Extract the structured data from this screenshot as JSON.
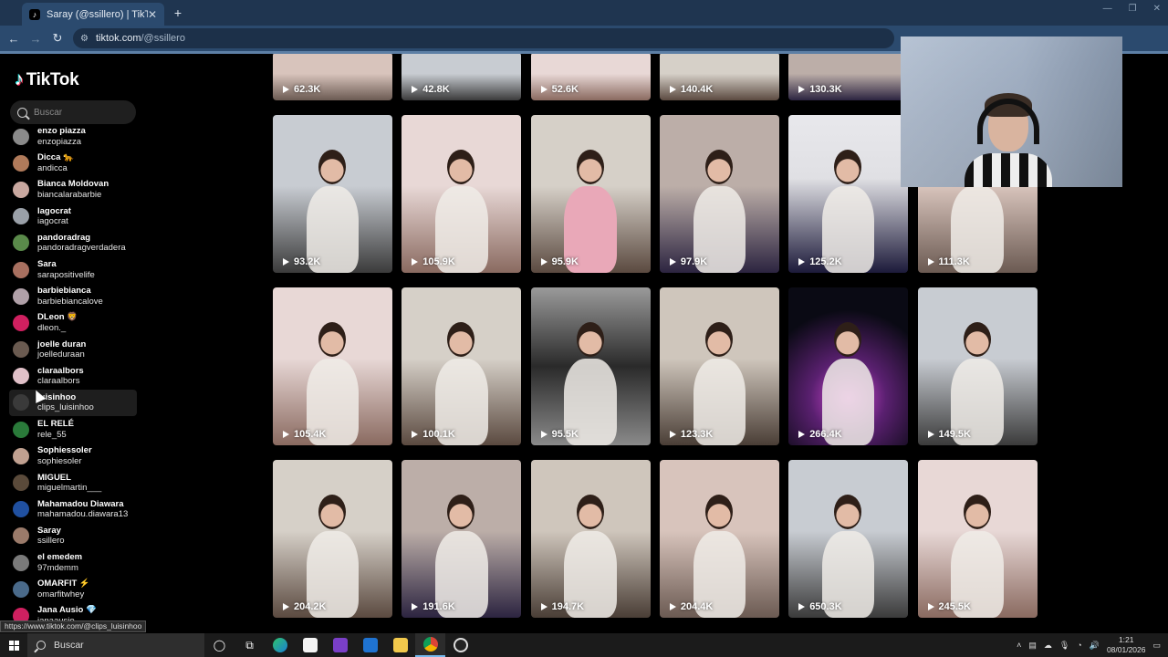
{
  "browser": {
    "tab_title": "Saray (@ssillero) | TikTok",
    "tab_close": "✕",
    "new_tab": "+",
    "url_host": "tiktok.com",
    "url_path": "/@ssillero",
    "back": "←",
    "forward": "→",
    "reload": "↻",
    "status_url": "https://www.tiktok.com/@clips_luisinhoo"
  },
  "tiktok": {
    "logo_text": "TikTok",
    "search_placeholder": "Buscar",
    "accounts": [
      {
        "display": "enzo piazza",
        "user": "enzopiazza",
        "color": "#8a8a8a"
      },
      {
        "display": "Dicca 🐆",
        "user": "andicca",
        "color": "#b07a5a"
      },
      {
        "display": "Bianca Moldovan",
        "user": "biancalarabarbie",
        "color": "#c9a8a0"
      },
      {
        "display": "Iagocrat",
        "user": "iagocrat",
        "color": "#9aa0a8"
      },
      {
        "display": "pandoradrag",
        "user": "pandoradragverdadera",
        "color": "#5a8a4a"
      },
      {
        "display": "Sara",
        "user": "sarapositivelife",
        "color": "#a87060"
      },
      {
        "display": "barbiebianca",
        "user": "barbiebiancalove",
        "color": "#b0a0a8"
      },
      {
        "display": "DLeon 🦁",
        "user": "dleon._",
        "color": "#d02060"
      },
      {
        "display": "joelle duran",
        "user": "joelleduraan",
        "color": "#6a5a50"
      },
      {
        "display": "claraalbors",
        "user": "claraalbors",
        "color": "#e0c0c8"
      },
      {
        "display": "luisinhoo",
        "user": "clips_luisinhoo",
        "color": "#3a3a3a"
      },
      {
        "display": "EL RELÉ",
        "user": "rele_55",
        "color": "#2a7a3a"
      },
      {
        "display": "Sophiessoler",
        "user": "sophiesoler",
        "color": "#c0a090"
      },
      {
        "display": "MIGUEL",
        "user": "miguelmartin___",
        "color": "#5a4a3a"
      },
      {
        "display": "Mahamadou Diawara",
        "user": "mahamadou.diawara13",
        "color": "#2050a0"
      },
      {
        "display": "Saray",
        "user": "ssillero",
        "color": "#9a7a6a"
      },
      {
        "display": "el emedem",
        "user": "97mdemm",
        "color": "#7a7a7a"
      },
      {
        "display": "OMARFIT ⚡",
        "user": "omarfitwhey",
        "color": "#4a6a8a"
      },
      {
        "display": "Jana Ausio 💎",
        "user": "janaausio",
        "color": "#d02060"
      }
    ]
  },
  "videos": {
    "row0": [
      "62.3K",
      "42.8K",
      "52.6K",
      "140.4K",
      "130.3K"
    ],
    "row1": [
      "93.2K",
      "105.9K",
      "95.9K",
      "97.9K",
      "125.2K",
      "111.3K"
    ],
    "row2": [
      "105.4K",
      "100.1K",
      "95.5K",
      "123.3K",
      "266.4K",
      "149.5K"
    ],
    "row3": [
      "204.2K",
      "191.6K",
      "194.7K",
      "204.4K",
      "650.3K",
      "245.5K"
    ]
  },
  "taskbar": {
    "search_label": "Buscar",
    "time": "1:21",
    "date": "08/01/2026"
  }
}
